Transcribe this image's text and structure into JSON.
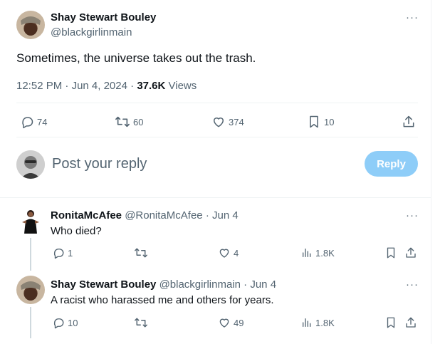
{
  "main_tweet": {
    "author_name": "Shay Stewart Bouley",
    "author_handle": "@blackgirlinmain",
    "text": "Sometimes, the universe takes out the trash.",
    "time": "12:52 PM",
    "date": "Jun 4, 2024",
    "views_count": "37.6K",
    "views_label": "Views",
    "replies": "74",
    "reposts": "60",
    "likes": "374",
    "bookmarks": "10"
  },
  "composer": {
    "placeholder": "Post your reply",
    "button_label": "Reply"
  },
  "replies": [
    {
      "author_name": "RonitaMcAfee",
      "author_handle": "@RonitaMcAfee",
      "date": "Jun 4",
      "text": "Who died?",
      "replies": "1",
      "reposts": "",
      "likes": "4",
      "views": "1.8K"
    },
    {
      "author_name": "Shay Stewart Bouley",
      "author_handle": "@blackgirlinmain",
      "date": "Jun 4",
      "text": "A racist who harassed me and others for years.",
      "replies": "10",
      "reposts": "",
      "likes": "49",
      "views": "1.8K"
    }
  ],
  "colors": {
    "accent": "#1d9bf0",
    "reply_button_disabled": "#8ecdf8",
    "muted_text": "#536471",
    "border": "#eff3f4"
  }
}
